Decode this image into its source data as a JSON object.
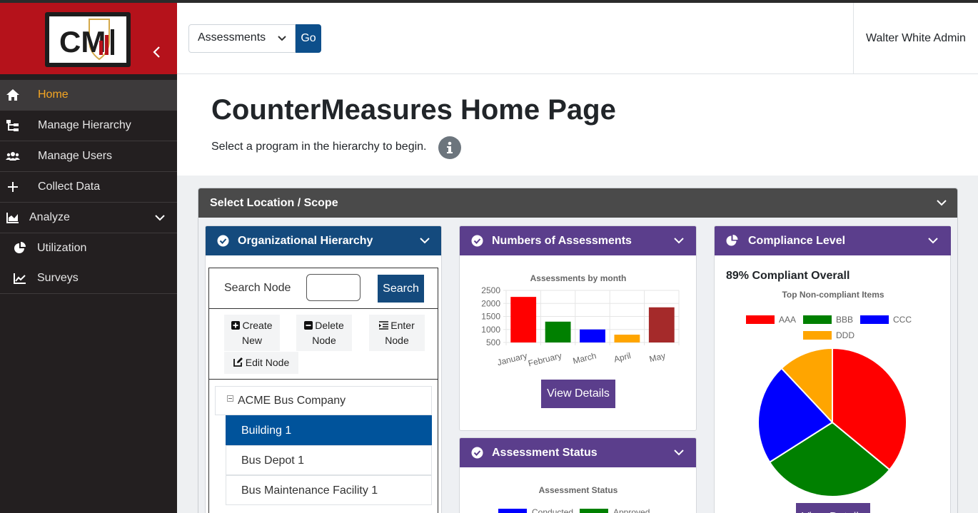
{
  "brand": {
    "logo_text": "CM"
  },
  "sidebar": {
    "items": [
      {
        "label": "Home",
        "icon": "home-icon",
        "active": true
      },
      {
        "label": "Manage Hierarchy",
        "icon": "hierarchy-icon"
      },
      {
        "label": "Manage Users",
        "icon": "users-icon"
      },
      {
        "label": "Collect Data",
        "icon": "plus-icon"
      },
      {
        "label": "Analyze",
        "icon": "area-chart-icon",
        "expanded": true
      },
      {
        "label": "Utilization",
        "icon": "pie-chart-icon"
      },
      {
        "label": "Surveys",
        "icon": "line-chart-icon"
      }
    ]
  },
  "topbar": {
    "select_value": "Assessments",
    "go_label": "Go",
    "user": "Walter White Admin"
  },
  "page": {
    "title": "CounterMeasures Home Page",
    "subtitle": "Select a program in the hierarchy to begin."
  },
  "location": {
    "title": "Select Location / Scope"
  },
  "org": {
    "title": "Organizational Hierarchy",
    "search_label": "Search Node",
    "search_value": "",
    "search_button": "Search",
    "tools": {
      "create_new": "Create New",
      "delete_node": "Delete Node",
      "enter_node": "Enter Node",
      "edit_node": "Edit Node"
    },
    "tree": {
      "root": "ACME Bus Company",
      "children": [
        "Building 1",
        "Bus Depot 1",
        "Bus Maintenance Facility 1"
      ],
      "selected": "Building 1"
    }
  },
  "numbers": {
    "title": "Numbers of Assessments",
    "view_details": "View Details"
  },
  "status": {
    "title": "Assessment Status",
    "chart_title": "Assessment Status",
    "legend": [
      "Conducted",
      "Approved"
    ]
  },
  "compliance": {
    "title": "Compliance Level",
    "summary": "89% Compliant Overall",
    "button_label": "View Details"
  },
  "colors": {
    "brand_red": "#b5121b",
    "sidebar": "#231f20",
    "active_orange": "#f5a623",
    "blue": "#144a7d",
    "purple": "#5b3e8c",
    "header_gray": "#4a4a4a"
  },
  "chart_data": [
    {
      "type": "bar",
      "title": "Assessments by month",
      "categories": [
        "January",
        "February",
        "March",
        "April",
        "May"
      ],
      "values": [
        2250,
        1300,
        1000,
        800,
        1850
      ],
      "colors": [
        "#ff0000",
        "#008000",
        "#0000ff",
        "#ffa500",
        "#a52a2a"
      ],
      "yticks": [
        500,
        1000,
        1500,
        2000,
        2500
      ],
      "ylim": [
        500,
        2500
      ],
      "grid": true,
      "legend": "none"
    },
    {
      "type": "pie",
      "title": "Top Non-compliant Items",
      "labels": [
        "AAA",
        "BBB",
        "CCC",
        "DDD"
      ],
      "values": [
        36,
        30,
        22,
        12
      ],
      "colors": [
        "#ff0000",
        "#008000",
        "#0000ff",
        "#ffa500"
      ],
      "legend": "top"
    }
  ]
}
